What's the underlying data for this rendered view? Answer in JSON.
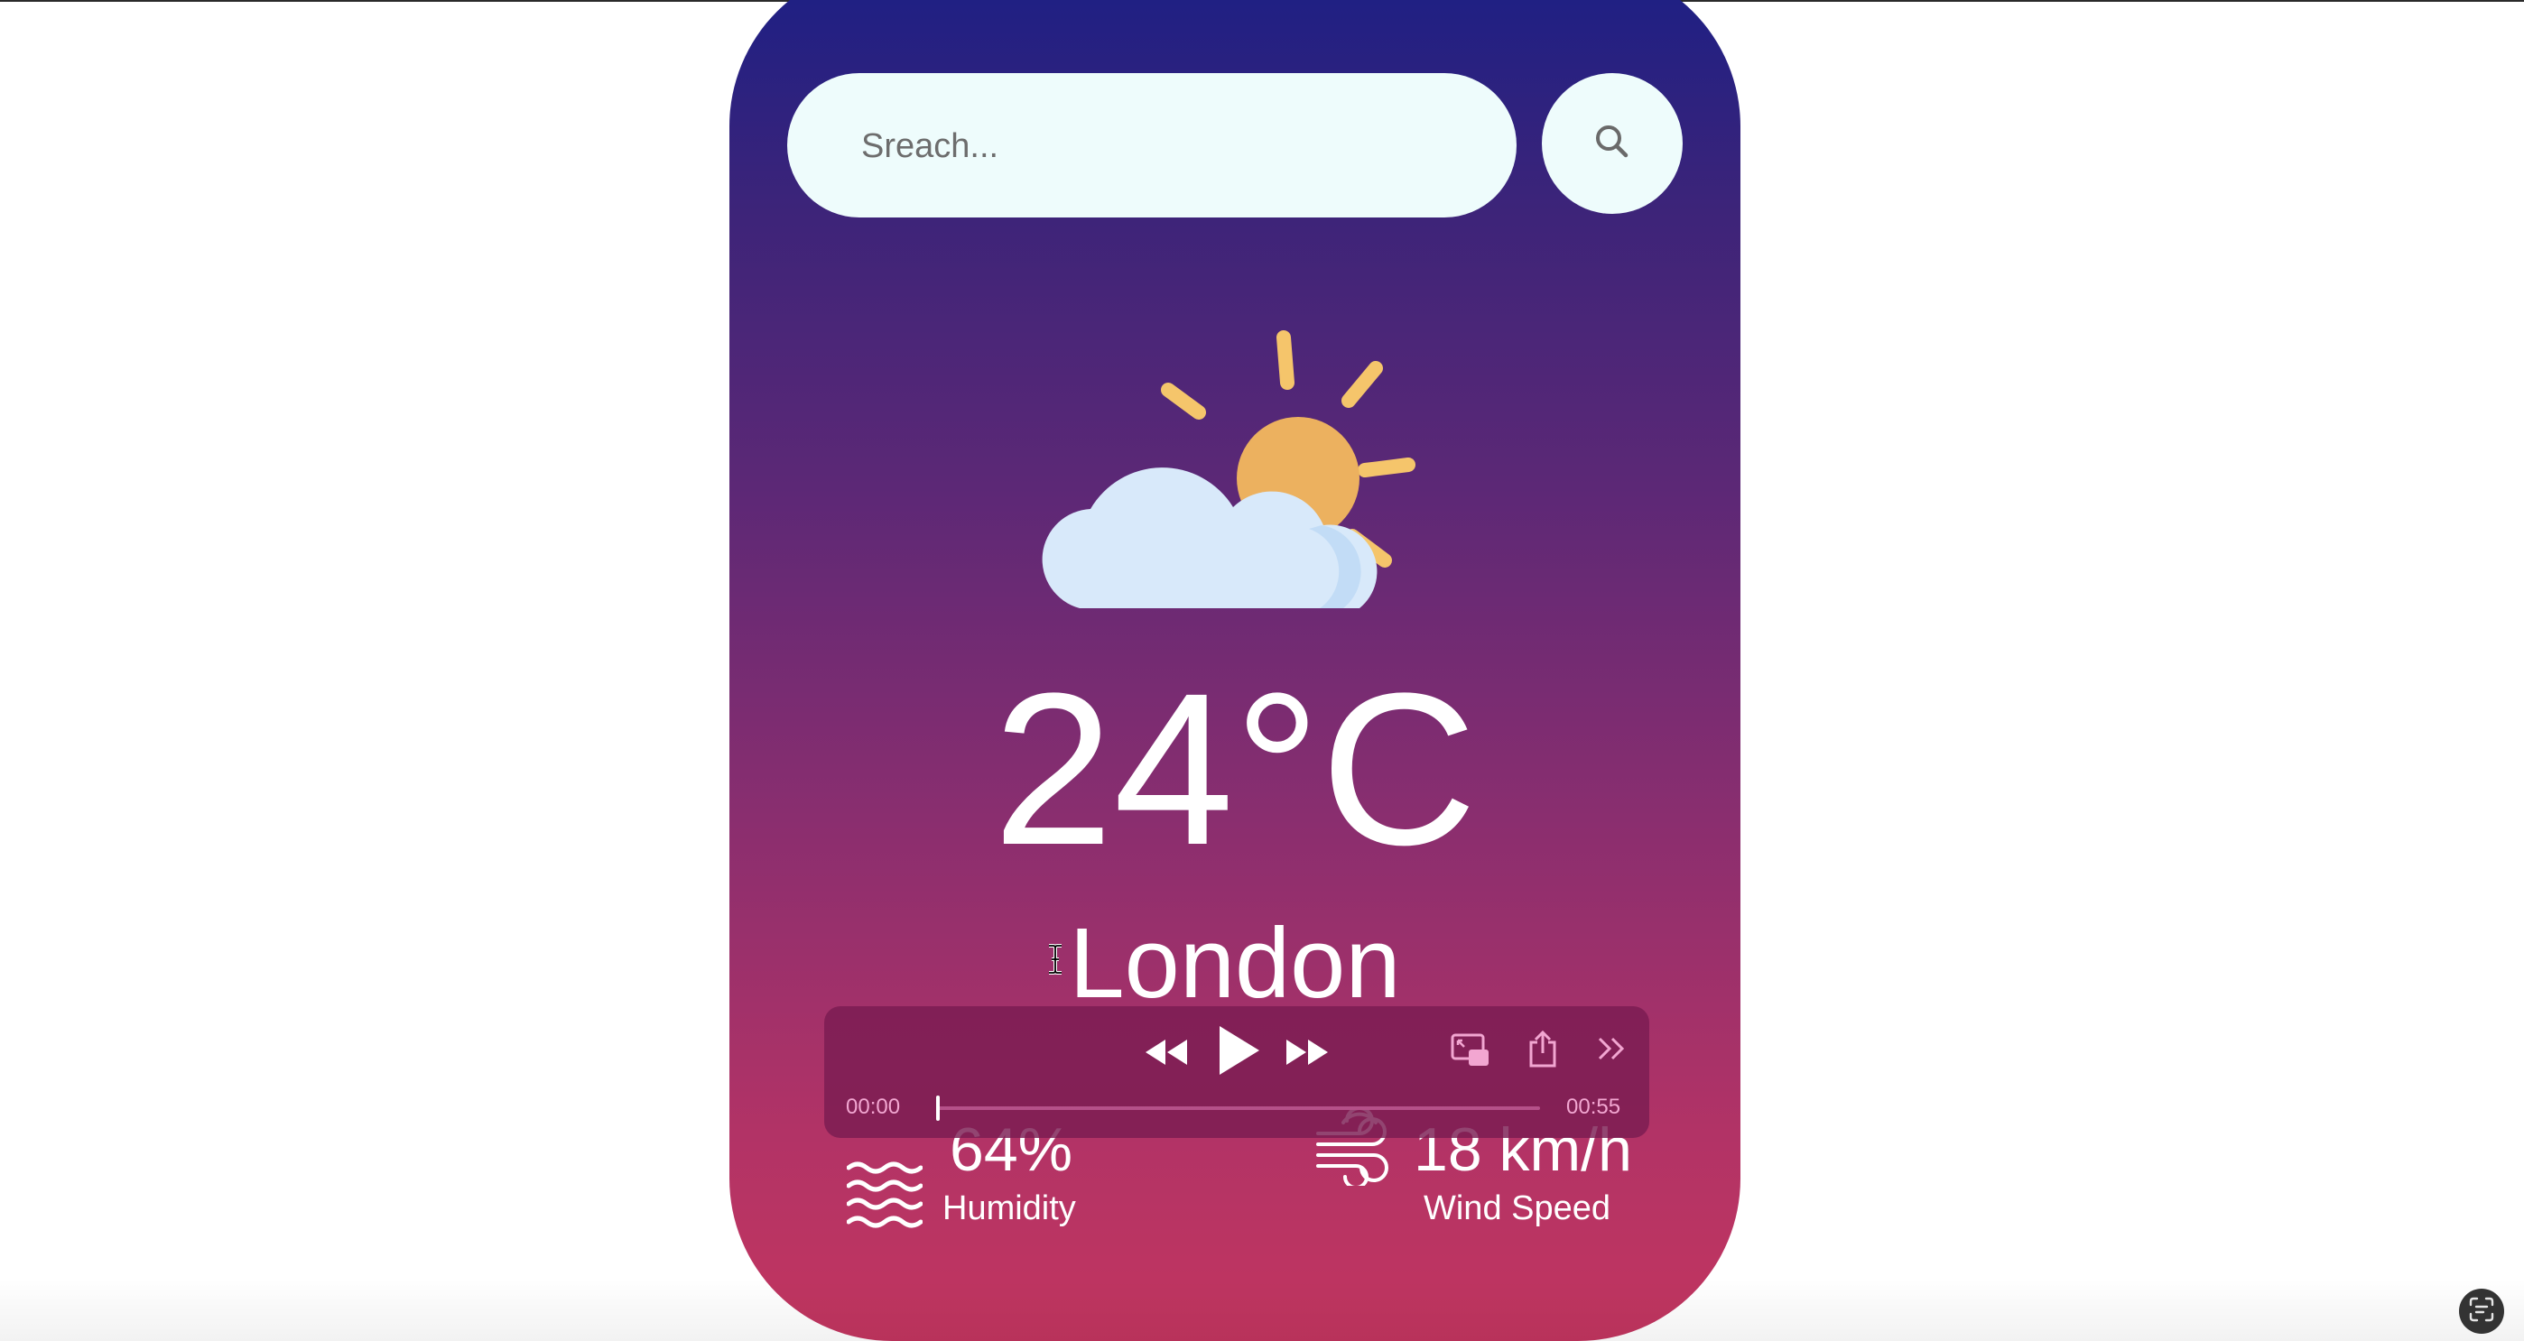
{
  "search": {
    "placeholder": "Sreach..."
  },
  "weather": {
    "temperature": "24°C",
    "city": "London",
    "condition_icon": "partly-cloudy-icon"
  },
  "details": {
    "humidity": {
      "value": "64%",
      "label": "Humidity",
      "icon": "humidity-waves-icon"
    },
    "wind": {
      "value": "18 km/h",
      "label": "Wind Speed",
      "icon": "wind-icon"
    }
  },
  "media_player": {
    "current_time": "00:00",
    "duration": "00:55",
    "progress": 0,
    "controls": [
      "rewind-icon",
      "play-icon",
      "fast-forward-icon",
      "picture-in-picture-icon",
      "share-icon",
      "more-chevron-icon"
    ]
  },
  "colors": {
    "card_top": "#1b1f85",
    "card_bottom": "#c2355f",
    "search_bg": "#eefcfc",
    "sun": "#ecb15f",
    "cloud": "#d8e9fa",
    "player_bg": "#7a1c52",
    "player_accent": "#f2a6d1"
  }
}
